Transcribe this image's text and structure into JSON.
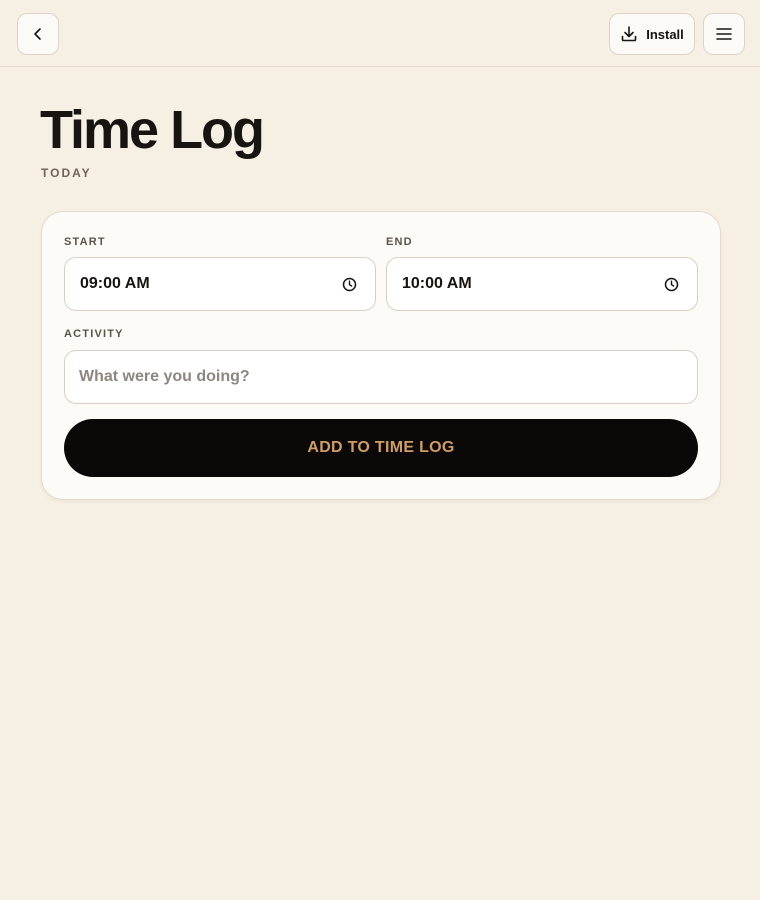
{
  "header": {
    "install_label": "Install",
    "icons": {
      "back": "chevron-left-icon",
      "install": "download-icon",
      "menu": "hamburger-menu-icon"
    }
  },
  "page": {
    "title": "Time Log",
    "subtitle": "TODAY"
  },
  "form": {
    "start_label": "START",
    "start_value": "09:00 AM",
    "end_label": "END",
    "end_value": "10:00 AM",
    "activity_label": "ACTIVITY",
    "activity_value": "",
    "activity_placeholder": "What were you doing?",
    "submit_label": "ADD TO TIME LOG",
    "time_icon": "clock-icon"
  },
  "colors": {
    "background": "#f6f0e4",
    "card": "#fdfbf8",
    "text": "#171412",
    "button": "#0a0908",
    "button_text": "#d19d62"
  }
}
